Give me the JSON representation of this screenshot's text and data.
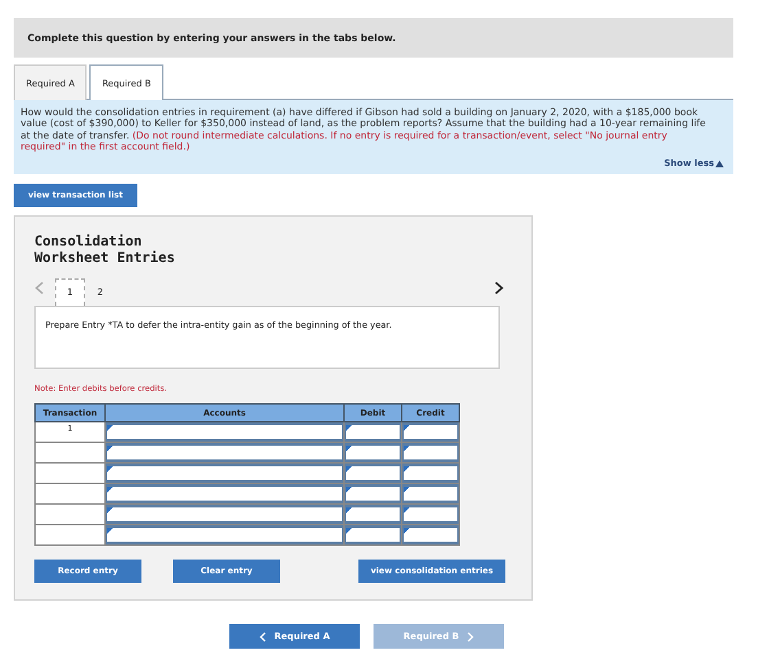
{
  "header": {
    "instruction": "Complete this question by entering your answers in the tabs below."
  },
  "tabs": [
    {
      "label": "Required A",
      "selected": false
    },
    {
      "label": "Required B",
      "selected": true
    }
  ],
  "question": {
    "text": "How would the consolidation entries in requirement (a) have differed if Gibson had sold a building on January 2, 2020, with a $185,000 book value (cost of $390,000) to Keller for $350,000 instead of land, as the problem reports? Assume that the building had a 10-year remaining life at the date of transfer.",
    "note": "(Do not round intermediate calculations. If no entry is required for a transaction/event, select \"No journal entry required\" in the first account field.)",
    "toggle": "Show less",
    "expanded": true
  },
  "view_transaction_list_button": "view transaction list",
  "worksheet": {
    "title": "Consolidation Worksheet Entries",
    "prev_disabled": true,
    "next_disabled": false,
    "pages": [
      {
        "label": "1",
        "selected": true
      },
      {
        "label": "2",
        "selected": false
      }
    ],
    "instruction": "Prepare Entry *TA to defer the intra-entity gain as of the beginning of the year.",
    "note": "Note: Enter debits before credits.",
    "columns": [
      "Transaction",
      "Accounts",
      "Debit",
      "Credit"
    ],
    "rows": [
      {
        "transaction": "1"
      },
      {},
      {},
      {},
      {},
      {}
    ],
    "buttons": [
      "Record entry",
      "Clear entry",
      "view consolidation entries"
    ]
  },
  "nav": [
    {
      "label": "Required A",
      "kind": "prev",
      "disabled": false
    },
    {
      "label": "Required B",
      "kind": "next",
      "disabled": true
    }
  ]
}
